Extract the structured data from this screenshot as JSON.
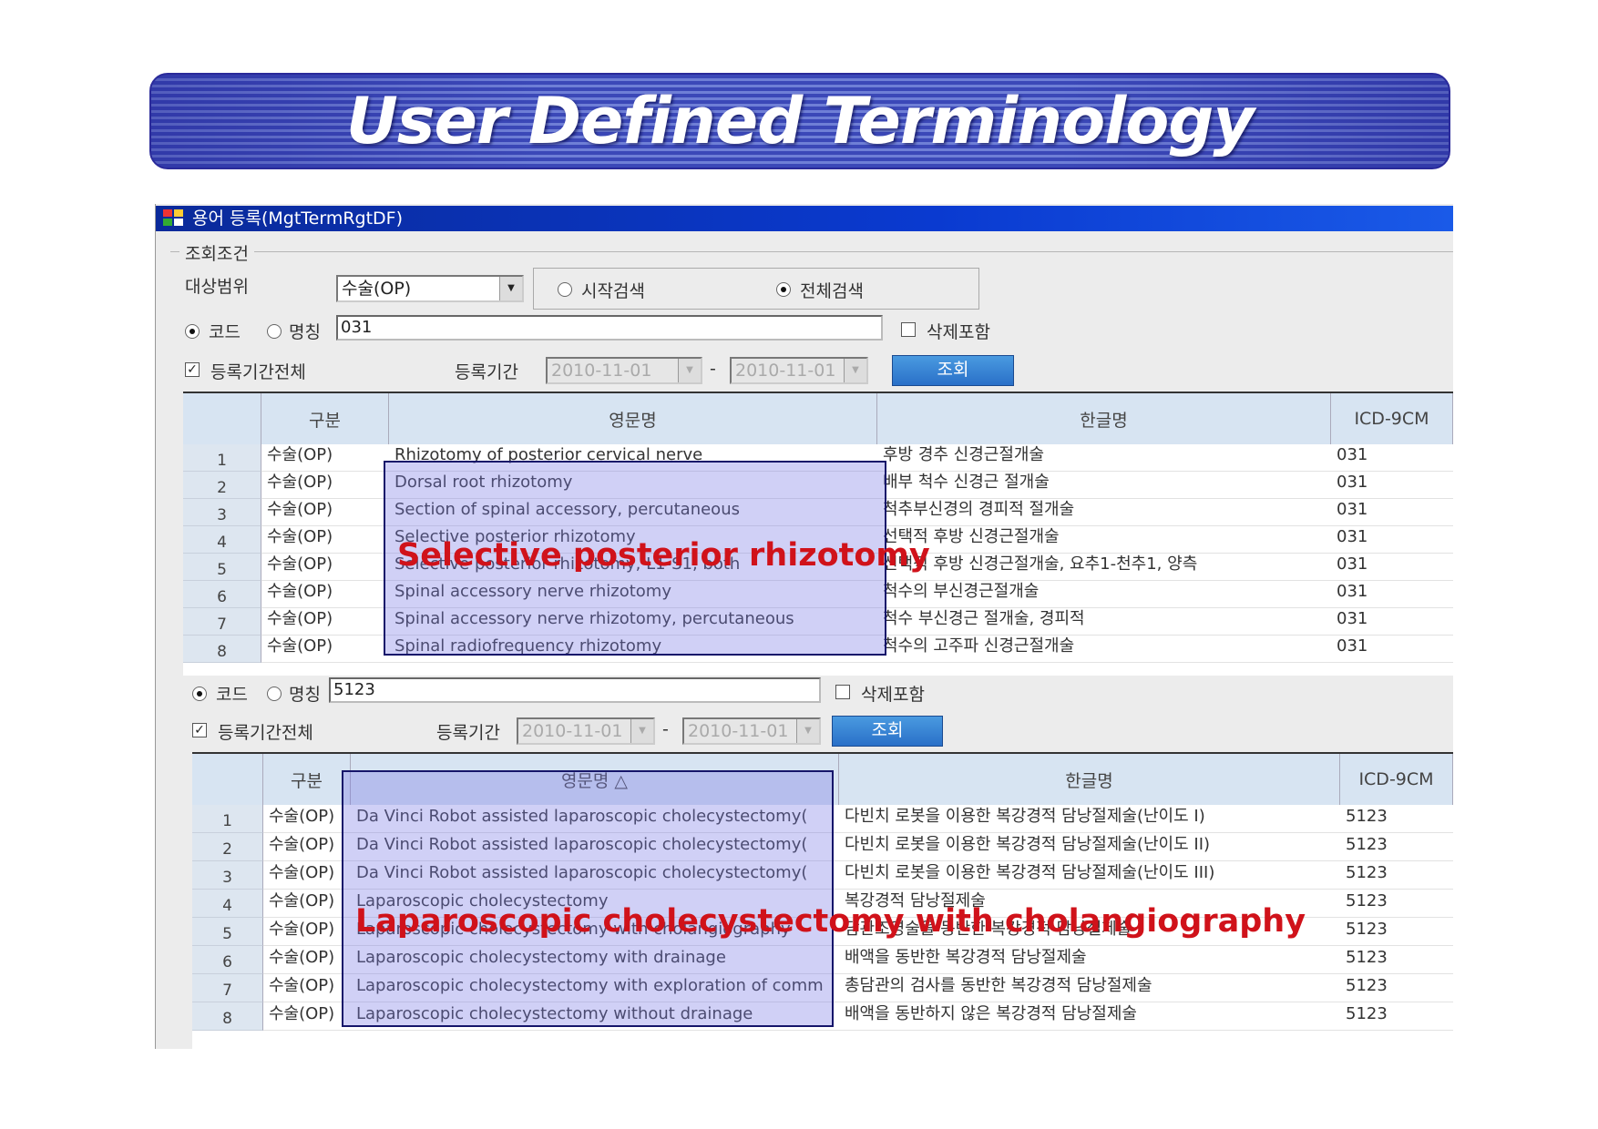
{
  "banner": {
    "title": "User Defined  Terminology"
  },
  "window": {
    "title": "용어 등록(MgtTermRgtDF)"
  },
  "search": {
    "group_label": "조회조건",
    "scope_label": "대상범위",
    "scope_value": "수술(OP)",
    "radio_start": "시작검색",
    "radio_all": "전체검색",
    "code_label": "코드",
    "name_label": "명칭",
    "delete_label": "삭제포함",
    "period_all_label": "등록기간전체",
    "period_label": "등록기간",
    "date_sep": "-",
    "search_button": "조회"
  },
  "panel1": {
    "search_value": "031",
    "date_from": "2010-11-01",
    "date_to": "2010-11-01",
    "columns": [
      "구분",
      "영문명",
      "한글명",
      "ICD-9CM"
    ],
    "rows": [
      {
        "n": "1",
        "cat": "수술(OP)",
        "en": "Rhizotomy of posterior cervical nerve",
        "ko": "후방 경추 신경근절개술",
        "code": "031"
      },
      {
        "n": "2",
        "cat": "수술(OP)",
        "en": "Dorsal root rhizotomy",
        "ko": "배부 척수 신경근 절개술",
        "code": "031"
      },
      {
        "n": "3",
        "cat": "수술(OP)",
        "en": "Section of spinal accessory, percutaneous",
        "ko": "척추부신경의 경피적 절개술",
        "code": "031"
      },
      {
        "n": "4",
        "cat": "수술(OP)",
        "en": "Selective posterior rhizotomy",
        "ko": "선택적 후방 신경근절개술",
        "code": "031"
      },
      {
        "n": "5",
        "cat": "수술(OP)",
        "en": "Selective posterior rhizotomy, L1-S1, both",
        "ko": "선택적 후방 신경근절개술, 요추1-천추1, 양측",
        "code": "031"
      },
      {
        "n": "6",
        "cat": "수술(OP)",
        "en": "Spinal accessory nerve rhizotomy",
        "ko": "척수의 부신경근절개술",
        "code": "031"
      },
      {
        "n": "7",
        "cat": "수술(OP)",
        "en": "Spinal accessory nerve rhizotomy, percutaneous",
        "ko": "척수 부신경근 절개술, 경피적",
        "code": "031"
      },
      {
        "n": "8",
        "cat": "수술(OP)",
        "en": "Spinal radiofrequency rhizotomy",
        "ko": "척수의 고주파 신경근절개술",
        "code": "031"
      }
    ],
    "overlay": "Selective posterior rhizotomy"
  },
  "panel2": {
    "search_value": "5123",
    "date_from": "2010-11-01",
    "date_to": "2010-11-01",
    "columns": [
      "구분",
      "영문명 △",
      "한글명",
      "ICD-9CM"
    ],
    "rows": [
      {
        "n": "1",
        "cat": "수술(OP)",
        "en": "Da Vinci Robot assisted laparoscopic cholecystectomy(",
        "ko": "다빈치 로봇을 이용한 복강경적 담낭절제술(난이도 I)",
        "code": "5123"
      },
      {
        "n": "2",
        "cat": "수술(OP)",
        "en": "Da Vinci Robot assisted laparoscopic cholecystectomy(",
        "ko": "다빈치 로봇을 이용한 복강경적 담낭절제술(난이도 II)",
        "code": "5123"
      },
      {
        "n": "3",
        "cat": "수술(OP)",
        "en": "Da Vinci Robot assisted laparoscopic cholecystectomy(",
        "ko": "다빈치 로봇을 이용한 복강경적 담낭절제술(난이도 III)",
        "code": "5123"
      },
      {
        "n": "4",
        "cat": "수술(OP)",
        "en": "Laparoscopic cholecystectomy",
        "ko": "복강경적 담낭절제술",
        "code": "5123"
      },
      {
        "n": "5",
        "cat": "수술(OP)",
        "en": "Laparoscopic cholecystectomy with cholangiography",
        "ko": "담관조영술을 동반한 복강경적 담낭절제술",
        "code": "5123"
      },
      {
        "n": "6",
        "cat": "수술(OP)",
        "en": "Laparoscopic cholecystectomy with drainage",
        "ko": "배액을 동반한 복강경적 담낭절제술",
        "code": "5123"
      },
      {
        "n": "7",
        "cat": "수술(OP)",
        "en": "Laparoscopic cholecystectomy with exploration of comm",
        "ko": "총담관의 검사를 동반한 복강경적 담낭절제술",
        "code": "5123"
      },
      {
        "n": "8",
        "cat": "수술(OP)",
        "en": "Laparoscopic cholecystectomy without drainage",
        "ko": "배액을 동반하지 않은 복강경적 담낭절제술",
        "code": "5123"
      }
    ],
    "overlay": "Laparoscopic  cholecystectomy with cholangiography"
  },
  "colors": {
    "titlebar": "#0a3ad0",
    "overlay_text": "#d0121a",
    "highlight_border": "#15156a",
    "button": "#2a70c8"
  }
}
